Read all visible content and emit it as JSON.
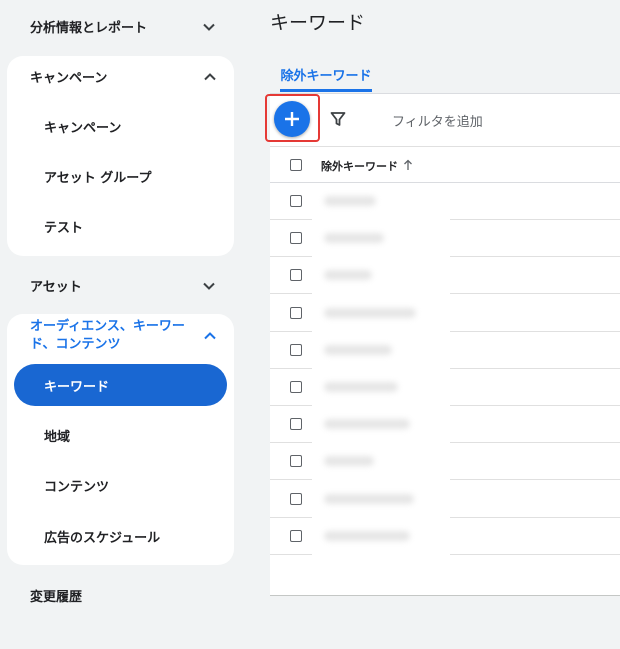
{
  "sidebar": {
    "analytics_label": "分析情報とレポート",
    "campaigns": {
      "label": "キャンペーン",
      "items": [
        "キャンペーン",
        "アセット グループ",
        "テスト"
      ]
    },
    "assets_label": "アセット",
    "audience": {
      "label": "オーディエンス、キーワード、コンテンツ",
      "items": [
        "キーワード",
        "地域",
        "コンテンツ",
        "広告のスケジュール"
      ],
      "active_item": "キーワード"
    },
    "history_label": "変更履歴"
  },
  "main": {
    "title": "キーワード",
    "tab_label": "除外キーワード",
    "toolbar": {
      "add_icon": "plus-icon",
      "filter_icon": "filter-icon",
      "filter_add_label": "フィルタを追加"
    },
    "table": {
      "column_header": "除外キーワード",
      "sort": "ascending",
      "row_count": 10
    }
  },
  "colors": {
    "accent": "#1a73e8",
    "active_nav": "#1967d2",
    "highlight": "#e53935"
  }
}
